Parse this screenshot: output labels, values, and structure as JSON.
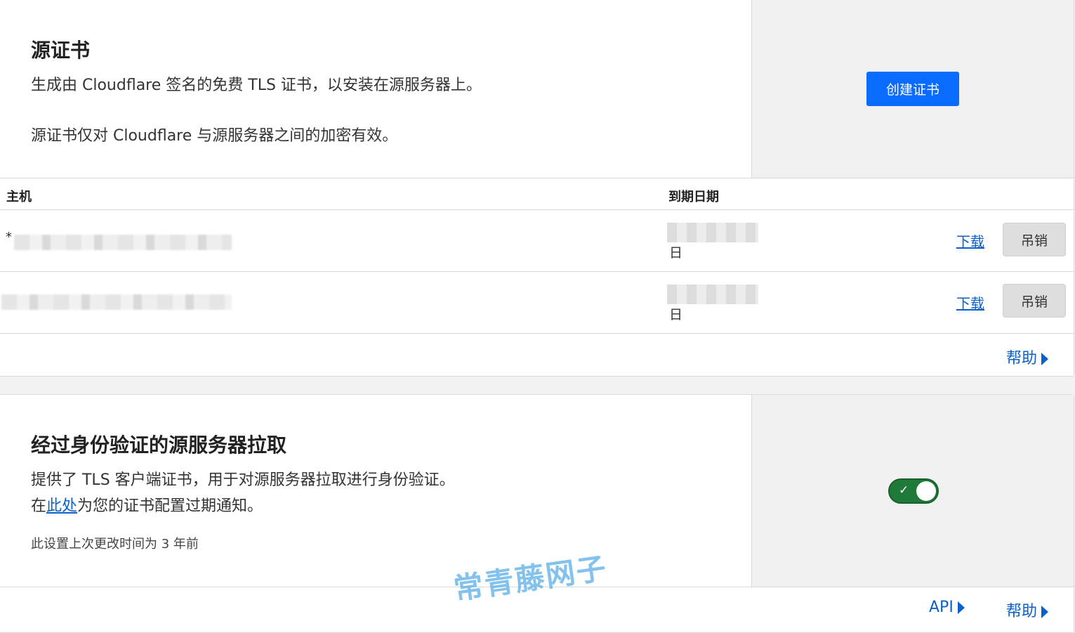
{
  "origin_certs": {
    "title": "源证书",
    "desc1": "生成由 Cloudflare 签名的免费 TLS 证书，以安装在源服务器上。",
    "desc2": "源证书仅对 Cloudflare 与源服务器之间的加密有效。",
    "create_button": "创建证书",
    "table": {
      "col_host": "主机",
      "col_expiry": "到期日期",
      "rows": [
        {
          "host_prefix": "*",
          "date_suffix": "日",
          "download": "下载",
          "revoke": "吊销"
        },
        {
          "host_prefix": "",
          "date_suffix": "日",
          "download": "下载",
          "revoke": "吊销"
        }
      ]
    },
    "help_link": "帮助"
  },
  "aop": {
    "title": "经过身份验证的源服务器拉取",
    "desc1": "提供了 TLS 客户端证书，用于对源服务器拉取进行身份验证。",
    "desc2_pre": "在",
    "desc2_link": "此处",
    "desc2_post": "为您的证书配置过期通知。",
    "last_changed": "此设置上次更改时间为 3 年前",
    "toggle_on": true,
    "api_link": "API",
    "help_link": "帮助"
  },
  "watermark": "常青藤网子",
  "colors": {
    "primary": "#0a6cff",
    "link": "#0b61c9",
    "toggle_on": "#1f7a3a"
  }
}
